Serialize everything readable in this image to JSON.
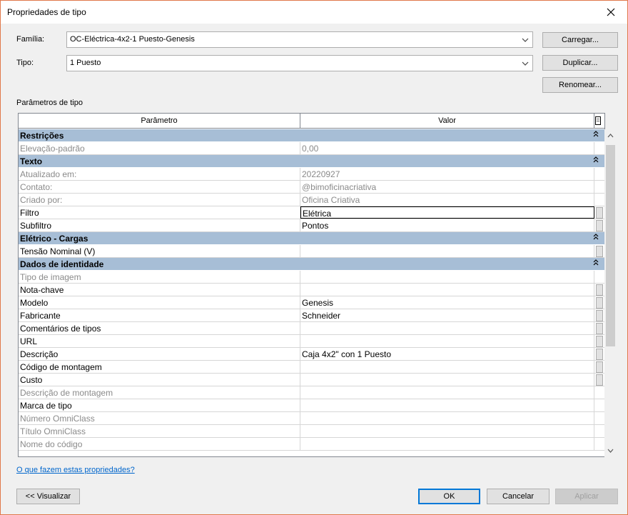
{
  "window": {
    "title": "Propriedades de tipo"
  },
  "family": {
    "label": "Família:",
    "value": "OC-Eléctrica-4x2-1 Puesto-Genesis"
  },
  "type": {
    "label": "Tipo:",
    "value": "1 Puesto"
  },
  "buttons": {
    "load": "Carregar...",
    "duplicate": "Duplicar...",
    "rename": "Renomear...",
    "preview": "<< Visualizar",
    "ok": "OK",
    "cancel": "Cancelar",
    "apply": "Aplicar"
  },
  "section_label": "Parâmetros de tipo",
  "grid": {
    "col_param": "Parâmetro",
    "col_value": "Valor",
    "groups": [
      {
        "name": "Restrições",
        "rows": [
          {
            "param": "Elevação-padrão",
            "value": "0,00",
            "readonly": true,
            "btn": false
          }
        ]
      },
      {
        "name": "Texto",
        "rows": [
          {
            "param": "Atualizado em:",
            "value": "20220927",
            "readonly": true,
            "btn": false
          },
          {
            "param": "Contato:",
            "value": "@bimoficinacriativa",
            "readonly": true,
            "btn": false
          },
          {
            "param": "Criado por:",
            "value": "Oficina Criativa",
            "readonly": true,
            "btn": false
          },
          {
            "param": "Filtro",
            "value": "Elétrica",
            "readonly": false,
            "btn": true,
            "selected": true
          },
          {
            "param": "Subfiltro",
            "value": "Pontos",
            "readonly": false,
            "btn": true
          }
        ]
      },
      {
        "name": "Elétrico - Cargas",
        "rows": [
          {
            "param": "Tensão Nominal (V)",
            "value": "",
            "readonly": false,
            "btn": true
          }
        ]
      },
      {
        "name": "Dados de identidade",
        "rows": [
          {
            "param": "Tipo de imagem",
            "value": "",
            "readonly": true,
            "btn": false
          },
          {
            "param": "Nota-chave",
            "value": "",
            "readonly": false,
            "btn": true
          },
          {
            "param": "Modelo",
            "value": "Genesis",
            "readonly": false,
            "btn": true
          },
          {
            "param": "Fabricante",
            "value": "Schneider",
            "readonly": false,
            "btn": true
          },
          {
            "param": "Comentários de tipos",
            "value": "",
            "readonly": false,
            "btn": true
          },
          {
            "param": "URL",
            "value": "",
            "readonly": false,
            "btn": true
          },
          {
            "param": "Descrição",
            "value": "Caja 4x2\" con 1 Puesto",
            "readonly": false,
            "btn": true
          },
          {
            "param": "Código de montagem",
            "value": "",
            "readonly": false,
            "btn": true
          },
          {
            "param": "Custo",
            "value": "",
            "readonly": false,
            "btn": true
          },
          {
            "param": "Descrição de montagem",
            "value": "",
            "readonly": true,
            "btn": false
          },
          {
            "param": "Marca de tipo",
            "value": "",
            "readonly": false,
            "btn": false
          },
          {
            "param": "Número OmniClass",
            "value": "",
            "readonly": true,
            "btn": false
          },
          {
            "param": "Título OmniClass",
            "value": "",
            "readonly": true,
            "btn": false
          },
          {
            "param": "Nome do código",
            "value": "",
            "readonly": true,
            "btn": false
          }
        ]
      }
    ]
  },
  "help_link": "O que fazem estas propriedades?"
}
